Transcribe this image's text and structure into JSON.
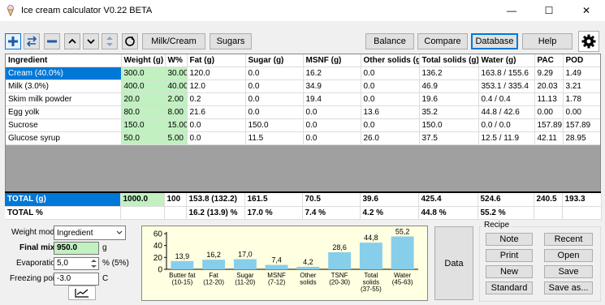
{
  "window": {
    "title": "Ice cream calculator  V0.22 BETA",
    "minimize_glyph": "—",
    "maximize_glyph": "☐",
    "close_glyph": "✕"
  },
  "toolbar": {
    "add_icon": "add-icon",
    "milk_cream_label": "Milk/Cream",
    "sugars_label": "Sugars",
    "balance_label": "Balance",
    "compare_label": "Compare",
    "database_label": "Database",
    "help_label": "Help"
  },
  "grid": {
    "columns": [
      "Ingredient",
      "Weight (g)",
      "W%",
      "Fat (g)",
      "Sugar (g)",
      "MSNF (g)",
      "Other solids (g)",
      "Total solids (g)",
      "Water (g)",
      "PAC",
      "POD"
    ],
    "rows": [
      [
        "Cream (40.0%)",
        "300.0",
        "30.00",
        "120.0",
        "0.0",
        "16.2",
        "0.0",
        "136.2",
        "163.8 / 155.6",
        "9.29",
        "1.49"
      ],
      [
        "Milk (3.0%)",
        "400.0",
        "40.00",
        "12.0",
        "0.0",
        "34.9",
        "0.0",
        "46.9",
        "353.1 / 335.4",
        "20.03",
        "3.21"
      ],
      [
        "Skim milk powder",
        "20.0",
        "2.00",
        "0.2",
        "0.0",
        "19.4",
        "0.0",
        "19.6",
        "0.4 / 0.4",
        "11.13",
        "1.78"
      ],
      [
        "Egg yolk",
        "80.0",
        "8.00",
        "21.6",
        "0.0",
        "0.0",
        "13.6",
        "35.2",
        "44.8 / 42.6",
        "0.00",
        "0.00"
      ],
      [
        "Sucrose",
        "150.0",
        "15.00",
        "0.0",
        "150.0",
        "0.0",
        "0.0",
        "150.0",
        "0.0 / 0.0",
        "157.89",
        "157.89"
      ],
      [
        "Glucose syrup",
        "50.0",
        "5.00",
        "0.0",
        "11.5",
        "0.0",
        "26.0",
        "37.5",
        "12.5 / 11.9",
        "42.11",
        "28.95"
      ]
    ],
    "total_g": [
      "TOTAL (g)",
      "1000.0",
      "100",
      "153.8 (132.2)",
      "161.5",
      "70.5",
      "39.6",
      "425.4",
      "524.6",
      "240.5",
      "193.3"
    ],
    "total_pct": [
      "TOTAL %",
      "",
      "",
      "16.2 (13.9) %",
      "17.0 %",
      "7.4 %",
      "4.2 %",
      "44.8 %",
      "55.2 %",
      "",
      ""
    ]
  },
  "settings": {
    "weight_mode_label": "Weight mode",
    "weight_mode_value": "Ingredient",
    "final_mix_label": "Final mix",
    "final_mix_value": "950.0",
    "final_mix_unit": "g",
    "evaporation_label": "Evaporation",
    "evaporation_value": "5,0",
    "evaporation_unit": "% (5%)",
    "freezing_point_label": "Freezing point",
    "freezing_point_value": "-3.0",
    "freezing_point_unit": "C"
  },
  "chart_data": {
    "type": "bar",
    "categories": [
      "Butter fat (10-15)",
      "Fat (12-20)",
      "Sugar (11-20)",
      "MSNF (7-12)",
      "Other solids",
      "TSNF (20-30)",
      "Total solids (37-55)",
      "Water (45-63)"
    ],
    "category_lines": [
      [
        "Butter fat",
        "(10-15)"
      ],
      [
        "Fat",
        "(12-20)"
      ],
      [
        "Sugar",
        "(11-20)"
      ],
      [
        "MSNF",
        "(7-12)"
      ],
      [
        "Other",
        "solids"
      ],
      [
        "TSNF",
        "(20-30)"
      ],
      [
        "Total",
        "solids",
        "(37-55)"
      ],
      [
        "Water",
        "(45-63)"
      ]
    ],
    "values": [
      13.9,
      16.2,
      17.0,
      7.4,
      4.2,
      28.6,
      44.8,
      55.2
    ],
    "value_labels": [
      "13,9",
      "16,2",
      "17,0",
      "7,4",
      "4,2",
      "28,6",
      "44,8",
      "55,2"
    ],
    "yticks": [
      "60",
      "40",
      "20",
      "0"
    ],
    "ylim": [
      0,
      60
    ],
    "bar_color": "#87ceeb"
  },
  "data_button_label": "Data",
  "recipe": {
    "label": "Recipe",
    "note": "Note",
    "recent": "Recent",
    "print": "Print",
    "open": "Open",
    "new": "New",
    "save": "Save",
    "standard": "Standard",
    "save_as": "Save as..."
  }
}
